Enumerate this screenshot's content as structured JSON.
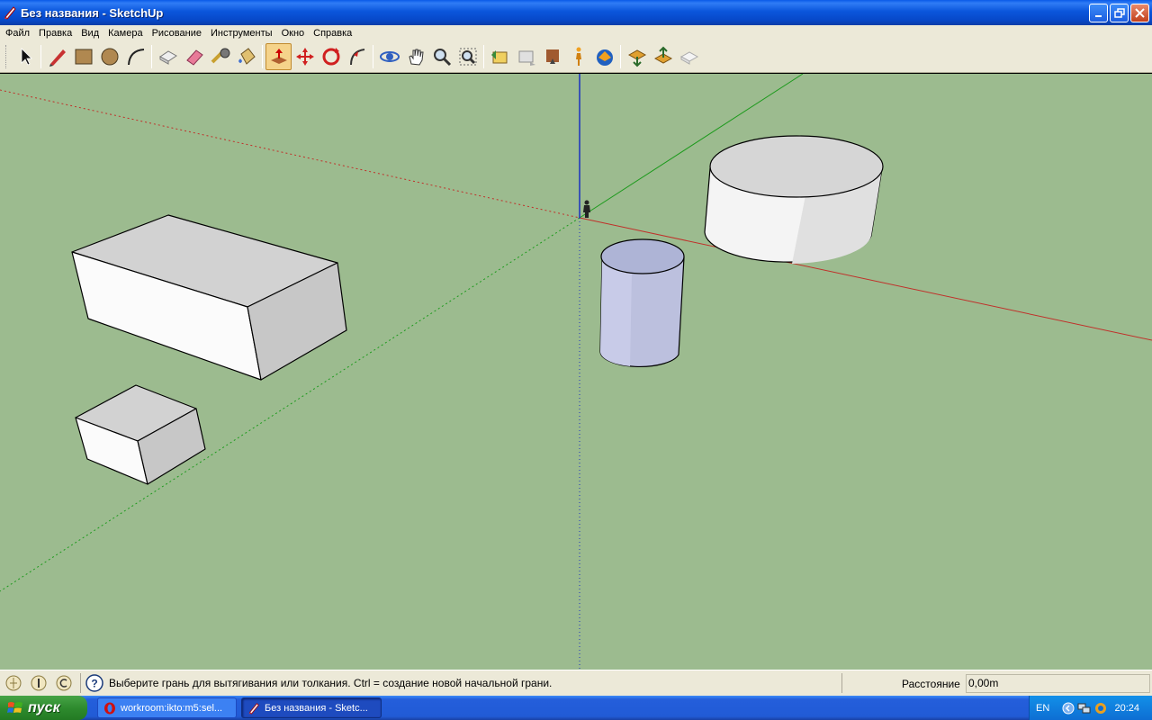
{
  "window": {
    "title": "Без названия - SketchUp",
    "controls": [
      "minimize",
      "restore",
      "close"
    ]
  },
  "menu": [
    "Файл",
    "Правка",
    "Вид",
    "Камера",
    "Рисование",
    "Инструменты",
    "Окно",
    "Справка"
  ],
  "toolbar": {
    "tools": [
      {
        "name": "select-tool",
        "icon": "arrow-cursor-icon"
      },
      {
        "name": "line-tool",
        "icon": "pencil-icon"
      },
      {
        "name": "rectangle-tool",
        "icon": "rectangle-icon"
      },
      {
        "name": "circle-tool",
        "icon": "circle-icon"
      },
      {
        "name": "arc-tool",
        "icon": "arc-icon"
      },
      {
        "name": "make-component-tool",
        "icon": "component-icon"
      },
      {
        "name": "eraser-tool",
        "icon": "eraser-icon"
      },
      {
        "name": "tape-measure-tool",
        "icon": "tape-measure-icon"
      },
      {
        "name": "paint-bucket-tool",
        "icon": "paint-bucket-icon"
      },
      {
        "name": "push-pull-tool",
        "icon": "push-pull-icon",
        "active": true
      },
      {
        "name": "move-tool",
        "icon": "move-icon"
      },
      {
        "name": "rotate-tool",
        "icon": "rotate-icon"
      },
      {
        "name": "follow-me-tool",
        "icon": "follow-me-icon"
      },
      {
        "name": "offset-tool",
        "icon": "offset-icon"
      },
      {
        "name": "orbit-tool",
        "icon": "orbit-icon"
      },
      {
        "name": "pan-tool",
        "icon": "hand-icon"
      },
      {
        "name": "zoom-tool",
        "icon": "magnifier-icon"
      },
      {
        "name": "zoom-extents-tool",
        "icon": "zoom-extents-icon"
      },
      {
        "name": "previous-view-tool",
        "icon": "previous-view-icon"
      },
      {
        "name": "next-view-tool",
        "icon": "next-view-icon"
      },
      {
        "name": "position-camera-tool",
        "icon": "position-camera-icon"
      },
      {
        "name": "walk-tool",
        "icon": "walk-icon"
      },
      {
        "name": "look-around-tool",
        "icon": "look-around-icon"
      },
      {
        "name": "get-models-tool",
        "icon": "get-models-icon"
      },
      {
        "name": "share-model-tool",
        "icon": "share-model-icon"
      },
      {
        "name": "share-component-tool",
        "icon": "share-component-icon"
      }
    ]
  },
  "viewport": {
    "background": "#9cbb8f",
    "axis_colors": {
      "red": "#c0302a",
      "green": "#1c9a1c",
      "blue": "#1a2fc0"
    },
    "objects": [
      "large-box",
      "small-box",
      "selected-cylinder",
      "large-cylinder",
      "human-figure"
    ]
  },
  "statusbar": {
    "icons": [
      "geo-location-icon",
      "credits-icon",
      "user-icon"
    ],
    "help_icon": "help-icon",
    "hint": "Выберите грань для вытягивания или толкания.  Ctrl = создание новой начальной грани.",
    "vcb_label": "Расстояние",
    "vcb_value": "0,00m"
  },
  "taskbar": {
    "start_label": "пуск",
    "tasks": [
      {
        "label": "workroom:ikto:m5:sel...",
        "icon": "opera-icon"
      },
      {
        "label": "Без названия - Sketc...",
        "icon": "sketchup-icon",
        "active": true
      }
    ],
    "tray": {
      "lang": "EN",
      "time": "20:24"
    }
  }
}
